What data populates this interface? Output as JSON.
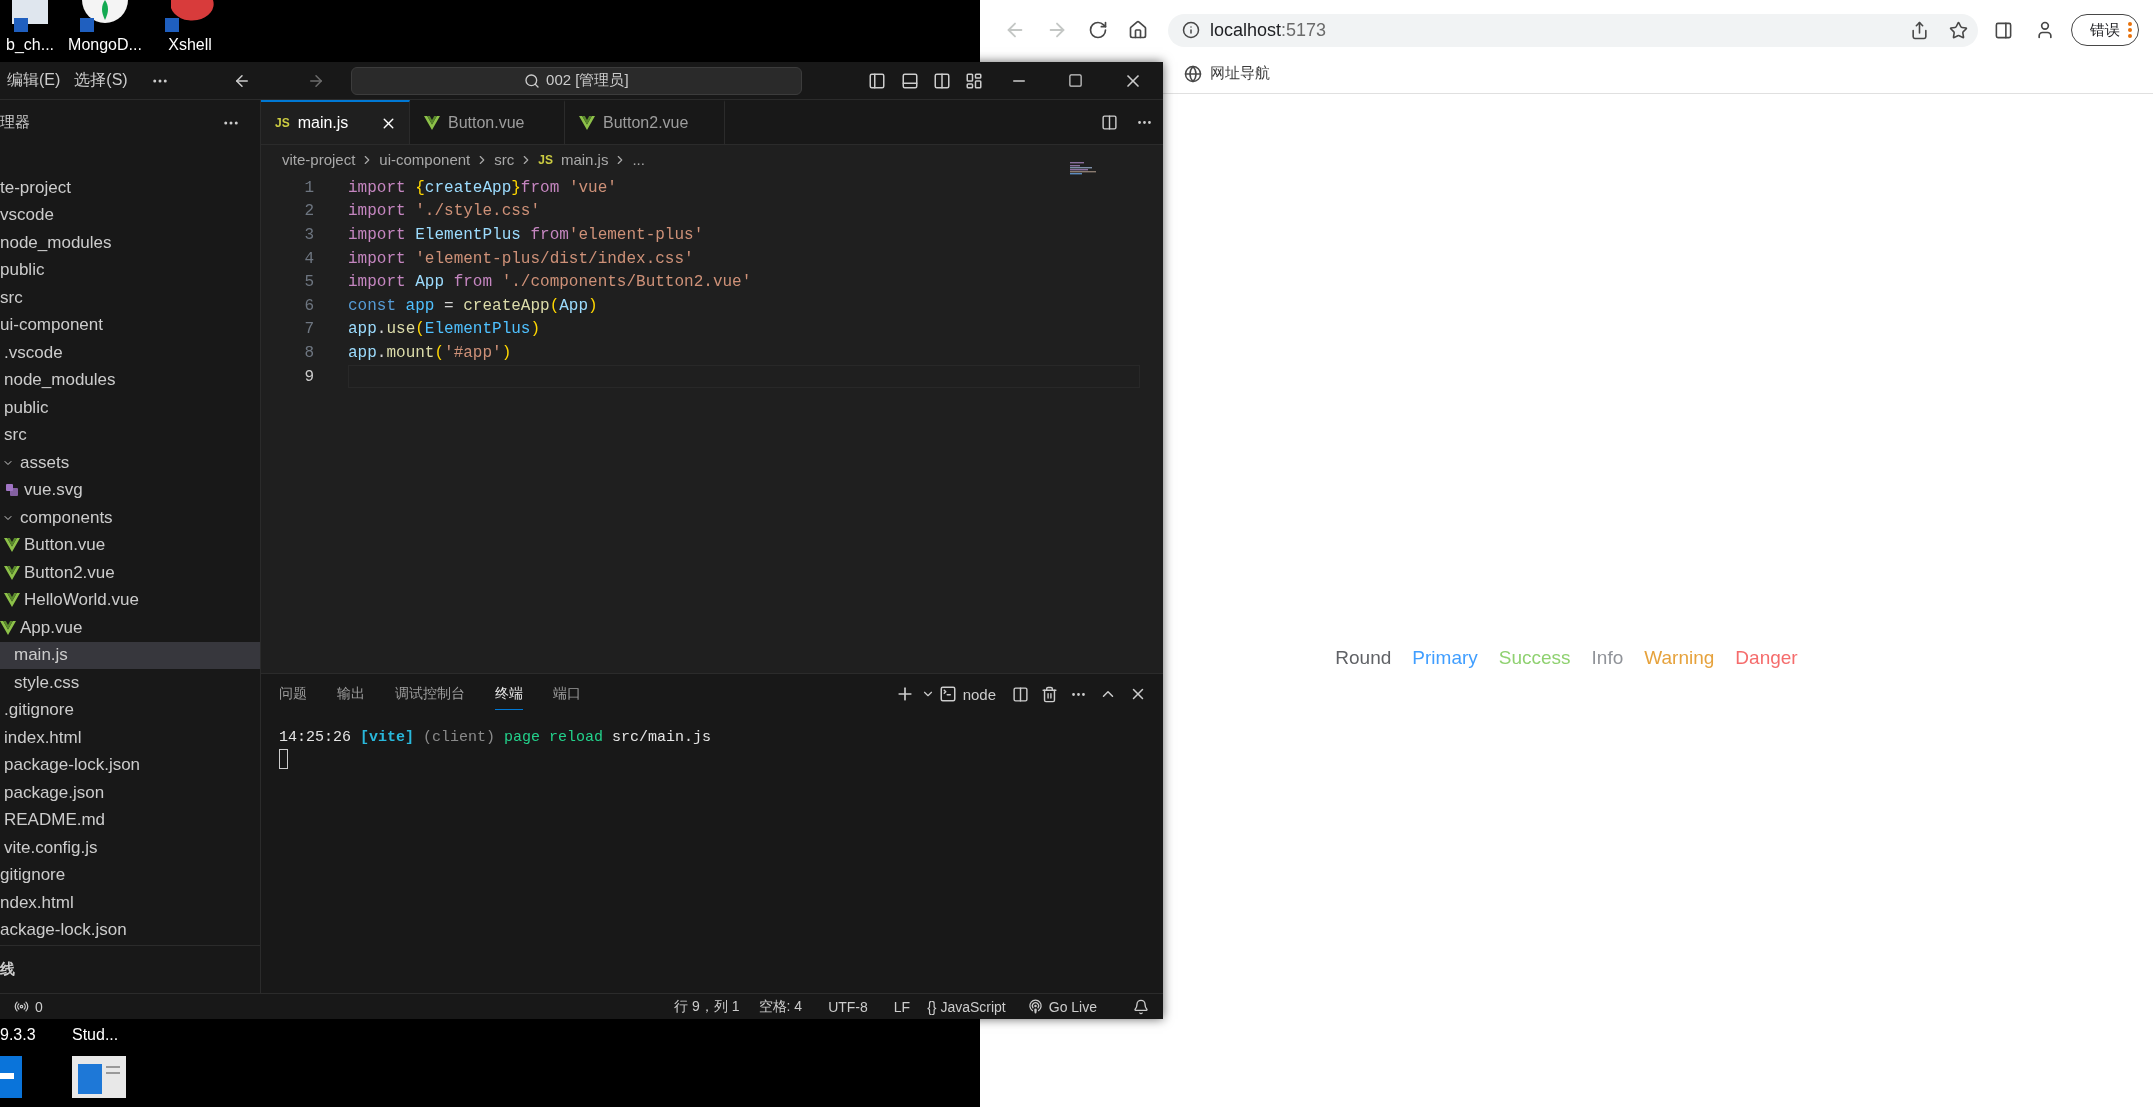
{
  "desktop": {
    "icons": [
      {
        "label": "b_ch...",
        "kind": "folder"
      },
      {
        "label": "MongoD...",
        "kind": "mongo"
      },
      {
        "label": "Xshell",
        "kind": "xshell"
      }
    ],
    "bottom_items": [
      {
        "label": "9.3.3",
        "kind": "edge"
      },
      {
        "label": "Stud...",
        "kind": "window"
      }
    ]
  },
  "vscode": {
    "menu": [
      "编辑(E)",
      "选择(S)"
    ],
    "search": "002 [管理员]",
    "explorer": {
      "title": "理器",
      "tree": [
        {
          "name": "te-project",
          "selected": false,
          "children": [
            {
              "name": "vscode",
              "selected": false
            },
            {
              "name": "node_modules",
              "selected": false
            },
            {
              "name": "public",
              "selected": false
            },
            {
              "name": "src",
              "selected": false
            },
            {
              "name": "ui-component",
              "selected": false,
              "children": [
                {
                  "name": ".vscode",
                  "selected": false
                },
                {
                  "name": "node_modules",
                  "selected": false
                },
                {
                  "name": "public",
                  "selected": false
                },
                {
                  "name": "src",
                  "selected": false,
                  "children": [
                    {
                      "name": "assets",
                      "expanded": true,
                      "selected": false,
                      "children": [
                        {
                          "name": "vue.svg",
                          "kind": "svg",
                          "selected": false
                        }
                      ]
                    },
                    {
                      "name": "components",
                      "expanded": true,
                      "selected": false,
                      "children": [
                        {
                          "name": "Button.vue",
                          "kind": "vue",
                          "selected": false
                        },
                        {
                          "name": "Button2.vue",
                          "kind": "vue",
                          "selected": false
                        },
                        {
                          "name": "HelloWorld.vue",
                          "kind": "vue",
                          "selected": false
                        }
                      ]
                    },
                    {
                      "name": "App.vue",
                      "kind": "vue",
                      "selected": false
                    },
                    {
                      "name": "main.js",
                      "selected": true
                    },
                    {
                      "name": "style.css",
                      "selected": false
                    }
                  ]
                },
                {
                  "name": ".gitignore",
                  "selected": false
                },
                {
                  "name": "index.html",
                  "selected": false
                },
                {
                  "name": "package-lock.json",
                  "selected": false
                },
                {
                  "name": "package.json",
                  "selected": false
                },
                {
                  "name": "README.md",
                  "selected": false
                },
                {
                  "name": "vite.config.js",
                  "selected": false
                }
              ]
            },
            {
              "name": "gitignore",
              "selected": false
            },
            {
              "name": "ndex.html",
              "selected": false
            },
            {
              "name": "ackage-lock.json",
              "selected": false
            }
          ]
        }
      ],
      "timeline_title": "线"
    },
    "tabs": [
      {
        "label": "main.js",
        "kind": "js",
        "badge": "JS",
        "selected": true
      },
      {
        "label": "Button.vue",
        "kind": "vue",
        "selected": false
      },
      {
        "label": "Button2.vue",
        "kind": "vue",
        "selected": false
      }
    ],
    "breadcrumb": [
      {
        "label": "vite-project"
      },
      {
        "label": "ui-component"
      },
      {
        "label": "src"
      },
      {
        "label": "main.js",
        "badge": "JS"
      },
      {
        "label": "..."
      }
    ],
    "code": [
      {
        "number": "1",
        "current": false,
        "tokens": [
          {
            "kind": "keyword",
            "text": "import "
          },
          {
            "kind": "bracket",
            "text": "{"
          },
          {
            "kind": "variable",
            "text": "createApp"
          },
          {
            "kind": "bracket",
            "text": "}"
          },
          {
            "kind": "keyword",
            "text": "from "
          },
          {
            "kind": "string",
            "text": "'vue'"
          }
        ]
      },
      {
        "number": "2",
        "current": false,
        "tokens": [
          {
            "kind": "keyword",
            "text": "import "
          },
          {
            "kind": "string",
            "text": "'./style.css'"
          }
        ]
      },
      {
        "number": "3",
        "current": false,
        "tokens": [
          {
            "kind": "keyword",
            "text": "import "
          },
          {
            "kind": "variable",
            "text": "ElementPlus "
          },
          {
            "kind": "keyword",
            "text": "from"
          },
          {
            "kind": "string",
            "text": "'element-plus'"
          }
        ]
      },
      {
        "number": "4",
        "current": false,
        "tokens": [
          {
            "kind": "keyword",
            "text": "import "
          },
          {
            "kind": "string",
            "text": "'element-plus/dist/index.css'"
          }
        ]
      },
      {
        "number": "5",
        "current": false,
        "tokens": [
          {
            "kind": "keyword",
            "text": "import "
          },
          {
            "kind": "variable",
            "text": "App "
          },
          {
            "kind": "keyword",
            "text": "from "
          },
          {
            "kind": "string",
            "text": "'./components/Button2.vue'"
          }
        ]
      },
      {
        "number": "6",
        "current": false,
        "tokens": [
          {
            "kind": "storage",
            "text": "const "
          },
          {
            "kind": "constant",
            "text": "app"
          },
          {
            "kind": "plain",
            "text": " = "
          },
          {
            "kind": "function",
            "text": "createApp"
          },
          {
            "kind": "bracket",
            "text": "("
          },
          {
            "kind": "variable",
            "text": "App"
          },
          {
            "kind": "bracket",
            "text": ")"
          }
        ]
      },
      {
        "number": "7",
        "current": false,
        "tokens": [
          {
            "kind": "variable",
            "text": "app"
          },
          {
            "kind": "plain",
            "text": "."
          },
          {
            "kind": "function",
            "text": "use"
          },
          {
            "kind": "bracket",
            "text": "("
          },
          {
            "kind": "constant",
            "text": "ElementPlus"
          },
          {
            "kind": "bracket",
            "text": ")"
          }
        ]
      },
      {
        "number": "8",
        "current": false,
        "tokens": [
          {
            "kind": "variable",
            "text": "app"
          },
          {
            "kind": "plain",
            "text": "."
          },
          {
            "kind": "function",
            "text": "mount"
          },
          {
            "kind": "bracket",
            "text": "("
          },
          {
            "kind": "string",
            "text": "'#app'"
          },
          {
            "kind": "bracket",
            "text": ")"
          }
        ]
      },
      {
        "number": "9",
        "current": true
      }
    ],
    "panel": {
      "tabs": [
        {
          "label": "问题",
          "selected": false
        },
        {
          "label": "输出",
          "selected": false
        },
        {
          "label": "调试控制台",
          "selected": false
        },
        {
          "label": "终端",
          "selected": true
        },
        {
          "label": "端口",
          "selected": false
        }
      ],
      "terminal_name": "node",
      "terminal_line": [
        {
          "kind": "time",
          "text": "14:25:26 "
        },
        {
          "kind": "tag",
          "text": "[vite] "
        },
        {
          "kind": "dim",
          "text": "(client) "
        },
        {
          "kind": "ok",
          "text": "page reload "
        },
        {
          "kind": "plain",
          "text": "src/main.js"
        }
      ]
    },
    "status_bar": {
      "ports": "0",
      "items": [
        {
          "kind": "text",
          "label": "行 9，列 1"
        },
        {
          "kind": "text",
          "label": "空格: 4"
        },
        {
          "kind": "text",
          "label": "UTF-8"
        },
        {
          "kind": "text",
          "label": "LF"
        },
        {
          "kind": "language",
          "badge": "{}",
          "label": "JavaScript"
        },
        {
          "kind": "golive",
          "label": "Go Live"
        },
        {
          "kind": "bell"
        }
      ]
    }
  },
  "browser": {
    "url_host": "localhost",
    "url_port": ":5173",
    "profile_button": "错误",
    "bookmarks": [
      {
        "label": "网址导航"
      }
    ],
    "buttons": [
      {
        "label": "Round",
        "color": "#606266"
      },
      {
        "label": "Primary",
        "color": "#409eff"
      },
      {
        "label": "Success",
        "color": "#8fd170"
      },
      {
        "label": "Info",
        "color": "#909399"
      },
      {
        "label": "Warning",
        "color": "#e6a23c"
      },
      {
        "label": "Danger",
        "color": "#f56c6c"
      }
    ]
  }
}
